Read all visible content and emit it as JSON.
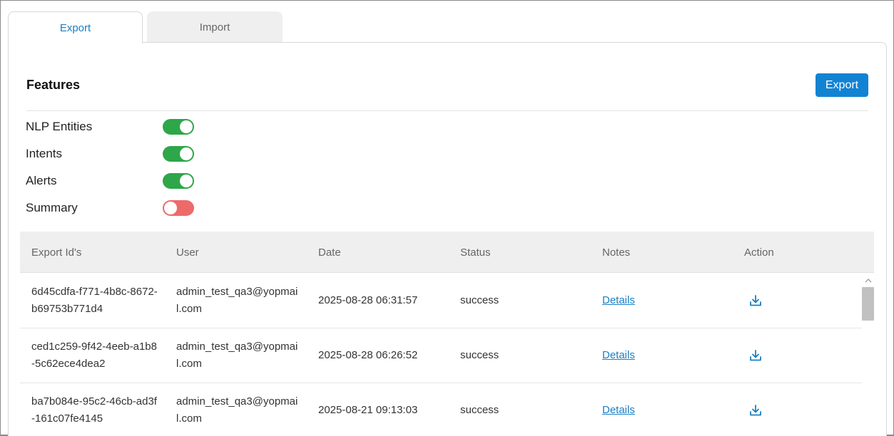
{
  "tabs": [
    {
      "label": "Export",
      "active": true
    },
    {
      "label": "Import",
      "active": false
    }
  ],
  "features": {
    "title": "Features",
    "export_button": "Export",
    "items": [
      {
        "label": "NLP Entities",
        "enabled": true
      },
      {
        "label": "Intents",
        "enabled": true
      },
      {
        "label": "Alerts",
        "enabled": true
      },
      {
        "label": "Summary",
        "enabled": false
      }
    ]
  },
  "table": {
    "columns": [
      "Export Id's",
      "User",
      "Date",
      "Status",
      "Notes",
      "Action"
    ],
    "rows": [
      {
        "id": "6d45cdfa-f771-4b8c-8672-b69753b771d4",
        "user": "admin_test_qa3@yopmail.com",
        "date": "2025-08-28 06:31:57",
        "status": "success",
        "notes": "Details"
      },
      {
        "id": "ced1c259-9f42-4eeb-a1b8-5c62ece4dea2",
        "user": "admin_test_qa3@yopmail.com",
        "date": "2025-08-28 06:26:52",
        "status": "success",
        "notes": "Details"
      },
      {
        "id": "ba7b084e-95c2-46cb-ad3f-161c07fe4145",
        "user": "admin_test_qa3@yopmail.com",
        "date": "2025-08-21 09:13:03",
        "status": "success",
        "notes": "Details"
      }
    ]
  },
  "colors": {
    "accent": "#1283d3",
    "toggle_on": "#2ea64a",
    "toggle_off": "#ee6a6a"
  },
  "icons": {
    "action": "download-icon",
    "scroll_up": "chevron-up-icon"
  }
}
